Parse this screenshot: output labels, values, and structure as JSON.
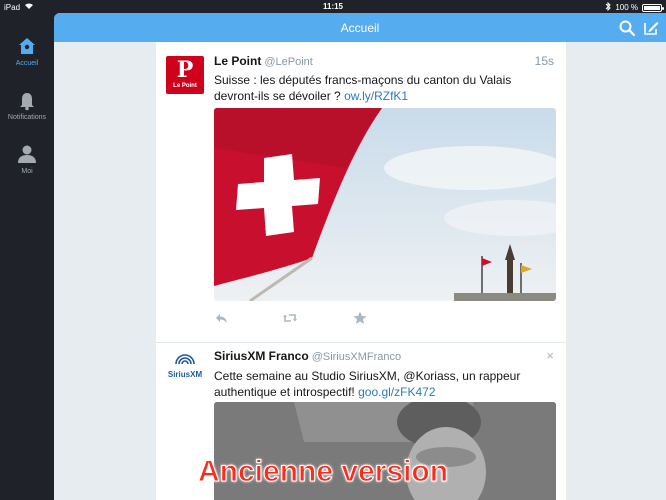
{
  "status_bar": {
    "device": "iPad",
    "time": "11:15",
    "battery": "100 %"
  },
  "sidebar": {
    "items": [
      {
        "label": "Accueil",
        "icon": "home-icon",
        "active": true
      },
      {
        "label": "Notifications",
        "icon": "bell-icon",
        "active": false
      },
      {
        "label": "Moi",
        "icon": "person-icon",
        "active": false
      }
    ]
  },
  "header": {
    "title": "Accueil"
  },
  "timeline": {
    "tweets": [
      {
        "display_name": "Le Point",
        "handle": "@LePoint",
        "time": "15s",
        "text": "Suisse : les députés francs-maçons du canton du Valais devront-ils se dévoiler ?",
        "link": "ow.ly/RZfK1",
        "avatar_letter": "P",
        "avatar_caption": "Le Point"
      },
      {
        "display_name": "SiriusXM Franco",
        "handle": "@SiriusXMFranco",
        "dismiss": "×",
        "text": "Cette semaine au Studio SiriusXM, @Koriass, un rappeur authentique et introspectif!",
        "link": "goo.gl/zFK472",
        "avatar_caption": "SiriusXM"
      }
    ]
  },
  "overlay": {
    "label": "Ancienne version"
  },
  "colors": {
    "accent": "#55acee",
    "sidebar_bg": "#1f2228",
    "link": "#2b7bb9",
    "overlay_text": "#ff2a1a"
  }
}
